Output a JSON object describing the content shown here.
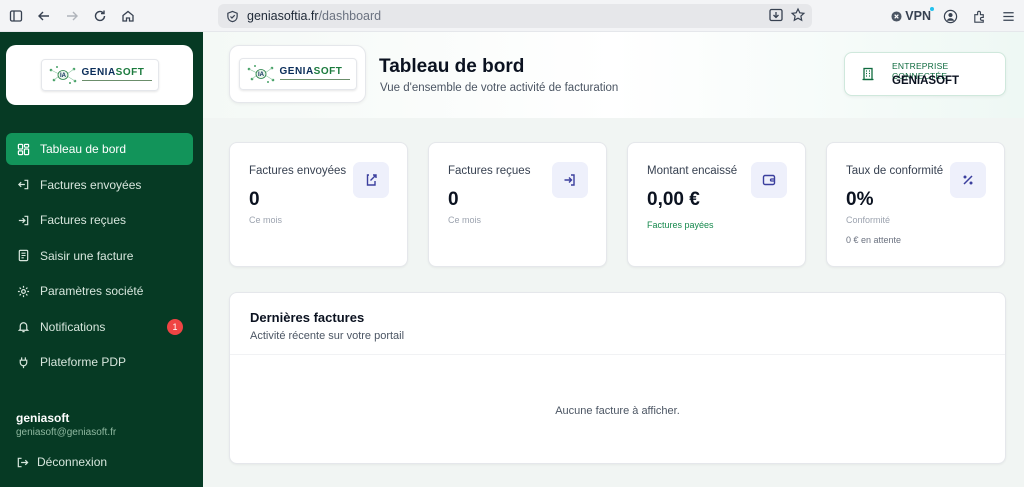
{
  "browser": {
    "url_host": "geniasoftia.fr",
    "url_path": "/dashboard",
    "vpn_label": "VPN"
  },
  "brand": {
    "logo_ia": "IA",
    "logo_name_a": "GENIA",
    "logo_name_b": "SOFT"
  },
  "sidebar": {
    "items": [
      {
        "label": "Tableau de bord",
        "icon": "dashboard-grid-icon",
        "active": true
      },
      {
        "label": "Factures envoyées",
        "icon": "send-icon"
      },
      {
        "label": "Factures reçues",
        "icon": "inbox-icon"
      },
      {
        "label": "Saisir une facture",
        "icon": "invoice-entry-icon"
      },
      {
        "label": "Paramètres société",
        "icon": "gear-icon"
      },
      {
        "label": "Notifications",
        "icon": "bell-icon",
        "badge": "1"
      },
      {
        "label": "Plateforme PDP",
        "icon": "plug-icon"
      }
    ],
    "user_name": "geniasoft",
    "user_email": "geniasoft@geniasoft.fr",
    "logout_label": "Déconnexion"
  },
  "header": {
    "title": "Tableau de bord",
    "subtitle": "Vue d'ensemble de votre activité de facturation",
    "company_label": "ENTREPRISE CONNECTÉE",
    "company_name": "GENIASOFT"
  },
  "stats": [
    {
      "label": "Factures envoyées",
      "value": "0",
      "note": "Ce mois",
      "icon": "export-icon"
    },
    {
      "label": "Factures reçues",
      "value": "0",
      "note": "Ce mois",
      "icon": "import-icon"
    },
    {
      "label": "Montant encaissé",
      "value": "0,00 €",
      "note": "Factures payées",
      "icon": "wallet-icon"
    },
    {
      "label": "Taux de conformité",
      "value": "0%",
      "note": "Conformité",
      "note2": "0 € en attente",
      "icon": "percent-icon"
    }
  ],
  "recent": {
    "title": "Dernières factures",
    "subtitle": "Activité récente sur votre portail",
    "empty": "Aucune facture à afficher."
  },
  "colors": {
    "sidebar_bg": "#063a24",
    "active_item": "#12945a",
    "badge": "#ef4444",
    "accent_green": "#16894d"
  }
}
